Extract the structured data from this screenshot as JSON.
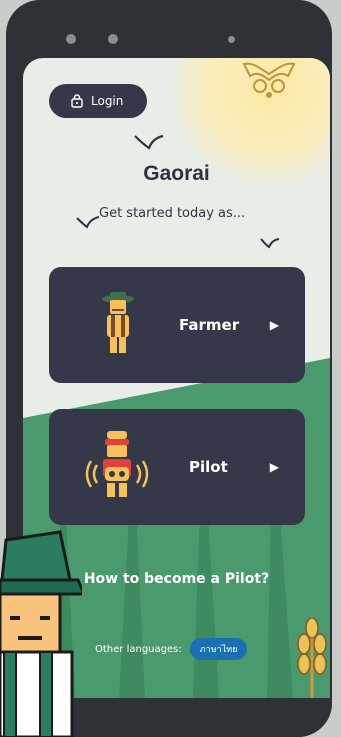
{
  "app": {
    "title": "Gaorai",
    "subtitle": "Get started today as..."
  },
  "header": {
    "login_label": "Login"
  },
  "roles": [
    {
      "label": "Farmer",
      "icon": "farmer-icon"
    },
    {
      "label": "Pilot",
      "icon": "pilot-icon"
    }
  ],
  "help": {
    "link_label": "How to become a Pilot?"
  },
  "languages": {
    "label": "Other languages:",
    "option": "ภาษาไทย"
  },
  "colors": {
    "card": "#353849",
    "field": "#4a9a6e",
    "field_dark": "#3f8a61",
    "sun": "#fbe7a3",
    "lang_button": "#1b6fb3"
  }
}
